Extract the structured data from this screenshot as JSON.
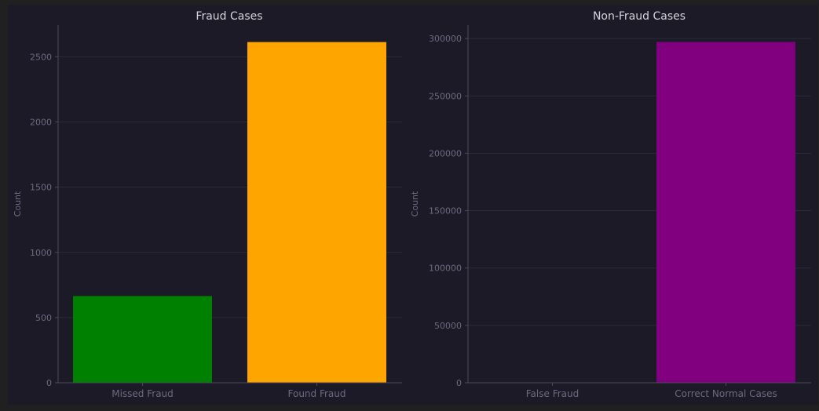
{
  "colors": {
    "figure_bg": "#202020",
    "axes_bg": "#1b1a26",
    "grid": "#2a2a3a",
    "spine": "#4a4a5a",
    "tick_text": "#6c6a80",
    "title_text": "#d4d4dc"
  },
  "chart_data": [
    {
      "type": "bar",
      "title": "Fraud Cases",
      "ylabel": "Count",
      "xlabel": "",
      "categories": [
        "Missed Fraud",
        "Found Fraud"
      ],
      "values": [
        665,
        2613
      ],
      "colors": [
        "#008000",
        "#ffa500"
      ],
      "ylim": [
        0,
        2743
      ],
      "yticks": [
        0,
        500,
        1000,
        1500,
        2000,
        2500
      ],
      "grid": true
    },
    {
      "type": "bar",
      "title": "Non-Fraud Cases",
      "ylabel": "Count",
      "xlabel": "",
      "categories": [
        "False Fraud",
        "Correct Normal Cases"
      ],
      "values": [
        180,
        297000
      ],
      "colors": [
        "#4b0082",
        "#800080"
      ],
      "ylim": [
        0,
        311700
      ],
      "yticks": [
        0,
        50000,
        100000,
        150000,
        200000,
        250000,
        300000
      ],
      "grid": true
    }
  ]
}
